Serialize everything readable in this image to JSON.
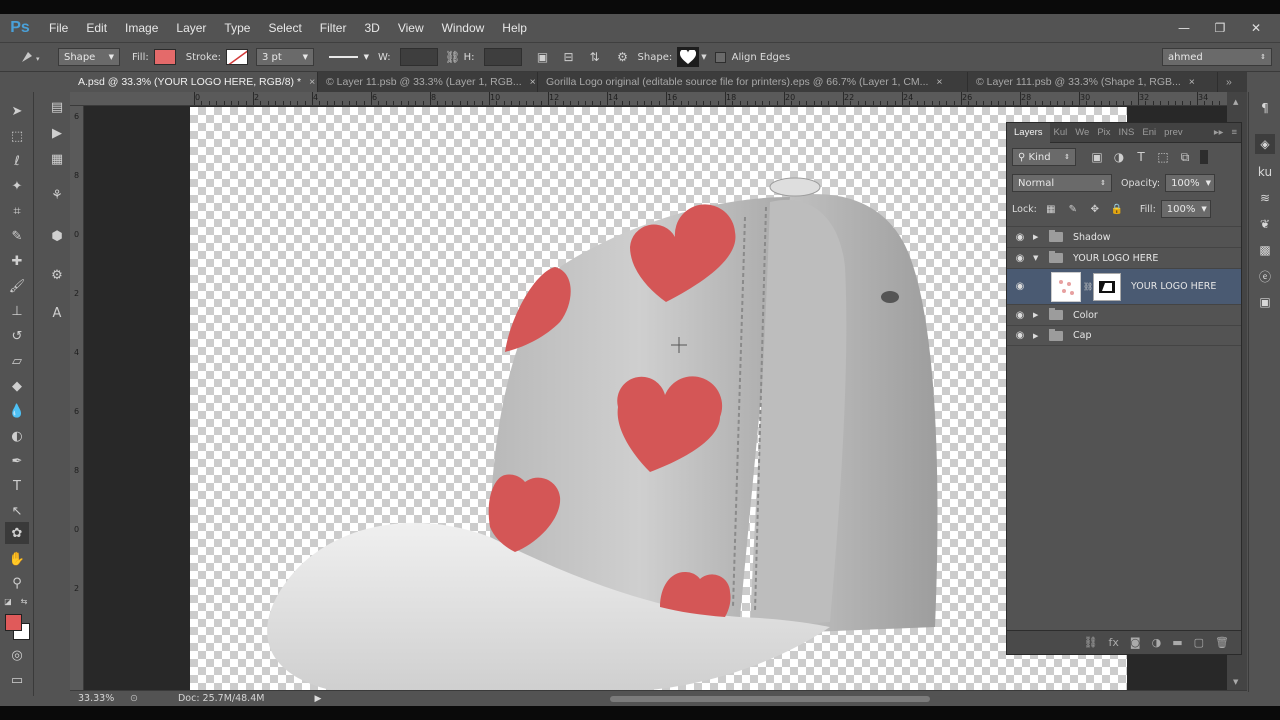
{
  "app": {
    "logo": "Ps"
  },
  "menu": [
    "File",
    "Edit",
    "Image",
    "Layer",
    "Type",
    "Select",
    "Filter",
    "3D",
    "View",
    "Window",
    "Help"
  ],
  "window_controls": {
    "minimize": "—",
    "restore": "❐",
    "close": "✕"
  },
  "options": {
    "mode": "Shape",
    "fill_label": "Fill:",
    "fill_color": "#e46a6a",
    "stroke_label": "Stroke:",
    "stroke_width": "3 pt",
    "w_label": "W:",
    "h_label": "H:",
    "shape_label": "Shape:",
    "align_edges": "Align Edges",
    "workspace": "ahmed"
  },
  "tabs": [
    {
      "label": "A.psd @ 33.3% (YOUR LOGO HERE, RGB/8) *",
      "active": true
    },
    {
      "label": "© Layer 11.psb @ 33.3% (Layer 1, RGB..."
    },
    {
      "label": "Gorilla Logo original (editable source file for printers).eps @ 66.7% (Layer 1, CM..."
    },
    {
      "label": "© Layer 111.psb @ 33.3% (Shape 1, RGB..."
    }
  ],
  "ruler_top": [
    "0",
    "2",
    "4",
    "6",
    "8",
    "10",
    "12",
    "14",
    "16",
    "18",
    "20",
    "22",
    "24",
    "26",
    "28",
    "30",
    "32",
    "34"
  ],
  "ruler_left": [
    "6",
    "8",
    "0",
    "2",
    "4",
    "6",
    "8",
    "0",
    "2"
  ],
  "status": {
    "zoom": "33.33%",
    "doc": "Doc: 25.7M/48.4M"
  },
  "colors": {
    "foreground": "#e05a5a",
    "background": "#ffffff",
    "heart": "#d45656"
  },
  "layers_panel": {
    "tabs": [
      "Layers",
      "Kul",
      "We",
      "Pix",
      "INS",
      "Eni",
      "prev"
    ],
    "filter": "Kind",
    "blend_mode": "Normal",
    "opacity_label": "Opacity:",
    "opacity": "100%",
    "lock_label": "Lock:",
    "fill_label": "Fill:",
    "fill": "100%",
    "layers": [
      {
        "name": "Shadow",
        "type": "group",
        "expanded": false
      },
      {
        "name": "YOUR LOGO HERE",
        "type": "group",
        "expanded": true
      },
      {
        "name": "YOUR LOGO HERE",
        "type": "smart-object",
        "selected": true
      },
      {
        "name": "Color",
        "type": "group",
        "expanded": false
      },
      {
        "name": "Cap",
        "type": "group",
        "expanded": false
      }
    ]
  }
}
